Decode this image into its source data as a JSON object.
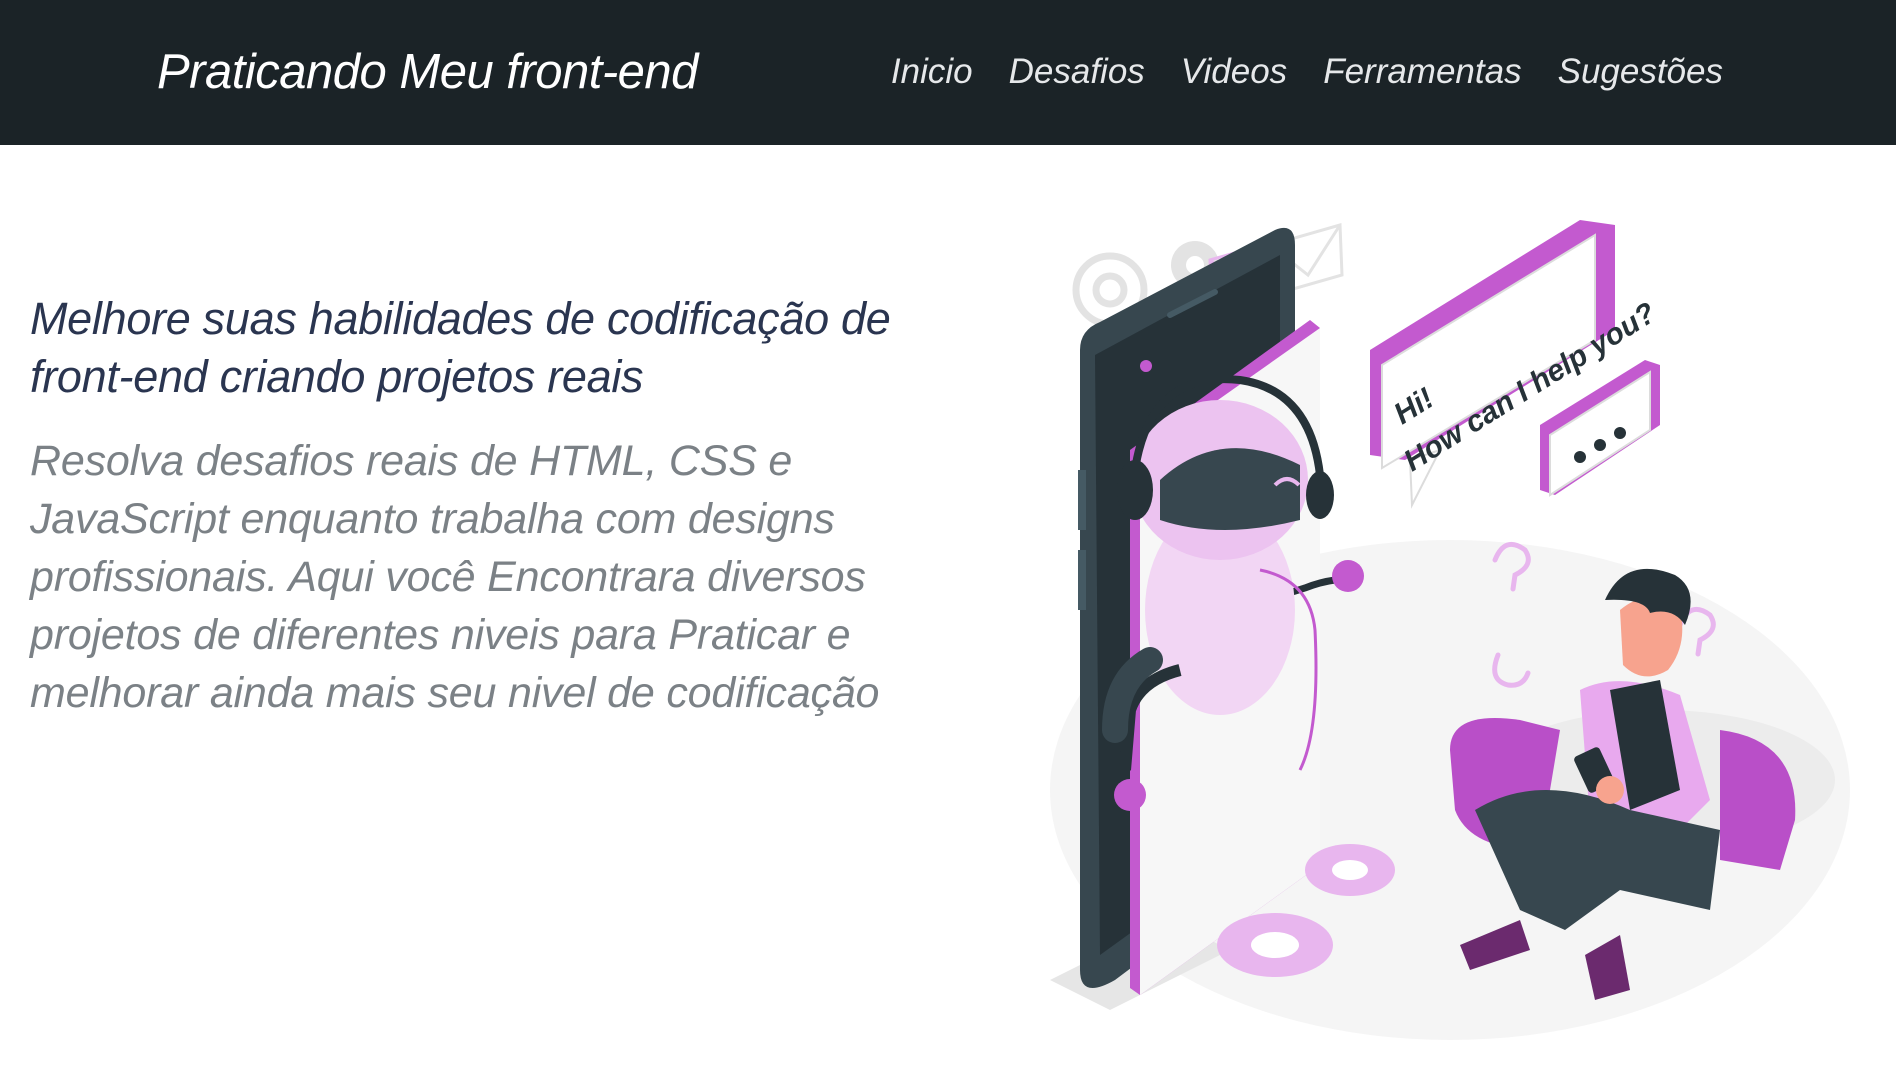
{
  "header": {
    "brand": "Praticando Meu front-end",
    "nav": [
      {
        "label": "Inicio"
      },
      {
        "label": "Desafios"
      },
      {
        "label": "Videos"
      },
      {
        "label": "Ferramentas"
      },
      {
        "label": "Sugestões"
      }
    ]
  },
  "hero": {
    "headline": "Melhore suas habilidades de codificação de front-end criando projetos reais",
    "description": "Resolva desafios reais de HTML, CSS e JavaScript enquanto trabalha com designs profissionais. Aqui você Encontrara diversos projetos de diferentes niveis para Praticar e melhorar ainda mais seu nivel de codificação"
  },
  "illustration": {
    "chat_line_1": "Hi!",
    "chat_line_2": "How can I help you?",
    "icons": [
      "phone-icon",
      "robot-icon",
      "person-icon",
      "chat-bubble-icon",
      "gear-icon",
      "envelope-icon",
      "question-mark-icon"
    ]
  },
  "colors": {
    "header_bg": "#1b2327",
    "headline": "#2a3550",
    "body_text": "#7b8186",
    "accent": "#b94fc8",
    "accent_light": "#eab8ef",
    "dark_ink": "#263238"
  }
}
